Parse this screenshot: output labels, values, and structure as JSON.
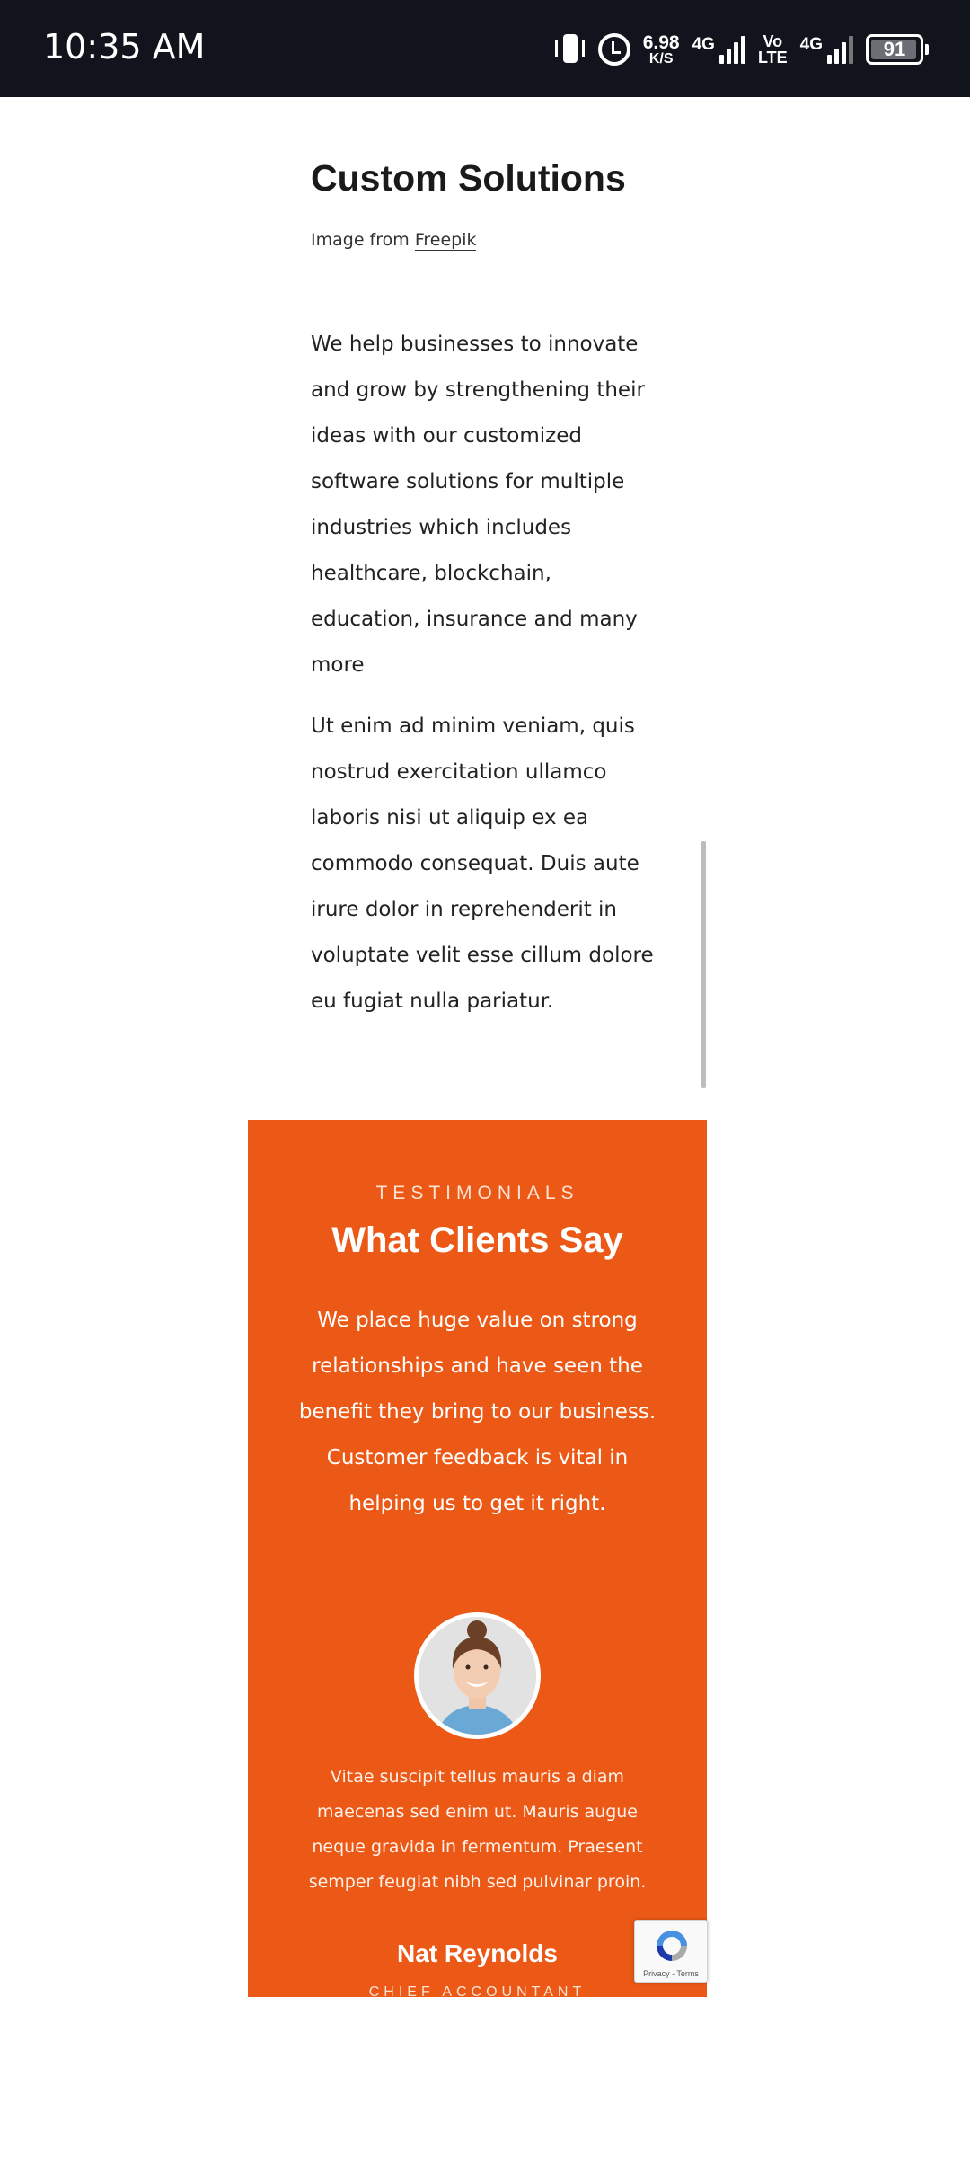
{
  "status_bar": {
    "time": "10:35 AM",
    "speed_value": "6.98",
    "speed_unit": "K/S",
    "net1_label": "4G",
    "volte_top": "Vo",
    "volte_bottom": "LTE",
    "net2_label": "4G",
    "battery": "91",
    "icons": [
      "vibrate-icon",
      "alarm-icon",
      "signal-icon",
      "battery-icon"
    ]
  },
  "page": {
    "title": "Custom Solutions",
    "credit_prefix": "Image from",
    "credit_link": "Freepik",
    "paragraph1": "We help businesses to innovate and grow by strengthening their ideas with our customized software solutions for multiple industries which includes healthcare, blockchain, education, insurance and many more",
    "paragraph2": "Ut enim ad minim veniam, quis nostrud exercitation ullamco laboris nisi ut aliquip ex ea commodo consequat. Duis aute irure dolor in reprehenderit in voluptate velit esse cillum dolore eu fugiat nulla pariatur."
  },
  "testimonials": {
    "eyebrow": "TESTIMONIALS",
    "title": "What Clients Say",
    "intro": "We place huge value on strong relationships and have seen the benefit they bring to our business. Customer feedback is vital in helping us to get it right.",
    "quote": "Vitae suscipit tellus mauris a diam maecenas sed enim ut. Mauris augue neque gravida in fermentum. Praesent semper feugiat nibh sed pulvinar proin.",
    "name": "Nat Reynolds",
    "role": "CHIEF ACCOUNTANT",
    "accent_color": "#ec5916"
  },
  "recaptcha": {
    "text": "Privacy - Terms"
  }
}
